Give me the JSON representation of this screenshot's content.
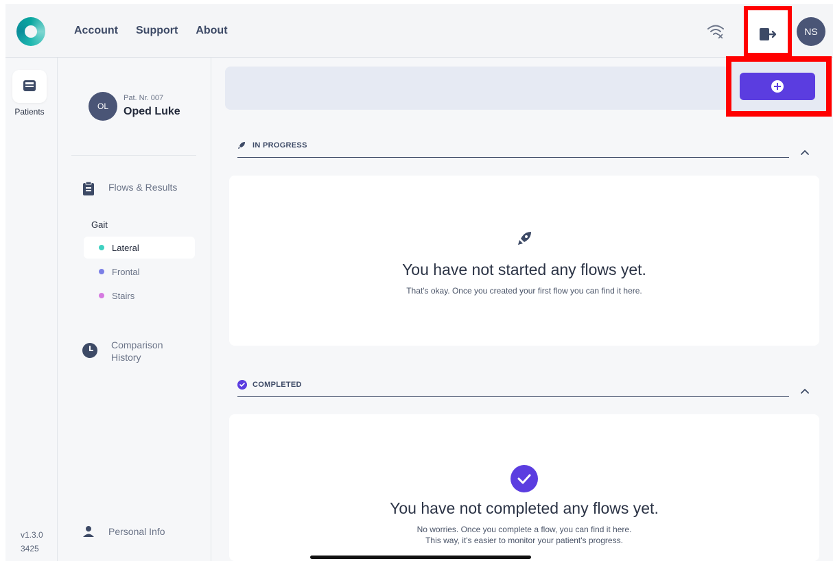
{
  "topnav": {
    "items": [
      "Account",
      "Support",
      "About"
    ]
  },
  "user": {
    "initials": "NS"
  },
  "rail": {
    "label": "Patients",
    "version": "v1.3.0",
    "build": "3425"
  },
  "patient": {
    "initials": "OL",
    "number": "Pat. Nr. 007",
    "name": "Oped Luke"
  },
  "sidebar": {
    "flows_label": "Flows & Results",
    "group": "Gait",
    "sub_items": [
      {
        "label": "Lateral",
        "color": "#3fd1c1"
      },
      {
        "label": "Frontal",
        "color": "#7b7fe6"
      },
      {
        "label": "Stairs",
        "color": "#d57ae0"
      }
    ],
    "comparison_line1": "Comparison",
    "comparison_line2": "History",
    "personal_info": "Personal Info"
  },
  "sections": {
    "in_progress": {
      "label": "IN PROGRESS",
      "title": "You have not started any flows yet.",
      "text": "That's okay. Once you created your first flow you can find it here."
    },
    "completed": {
      "label": "COMPLETED",
      "title": "You have not completed any flows yet.",
      "text1": "No worries. Once you complete a flow, you can find it here.",
      "text2": "This way, it's easier to monitor your patient's progress."
    }
  },
  "colors": {
    "accent": "#5b3de0",
    "highlight": "#ff0000",
    "navy": "#4a5576"
  }
}
